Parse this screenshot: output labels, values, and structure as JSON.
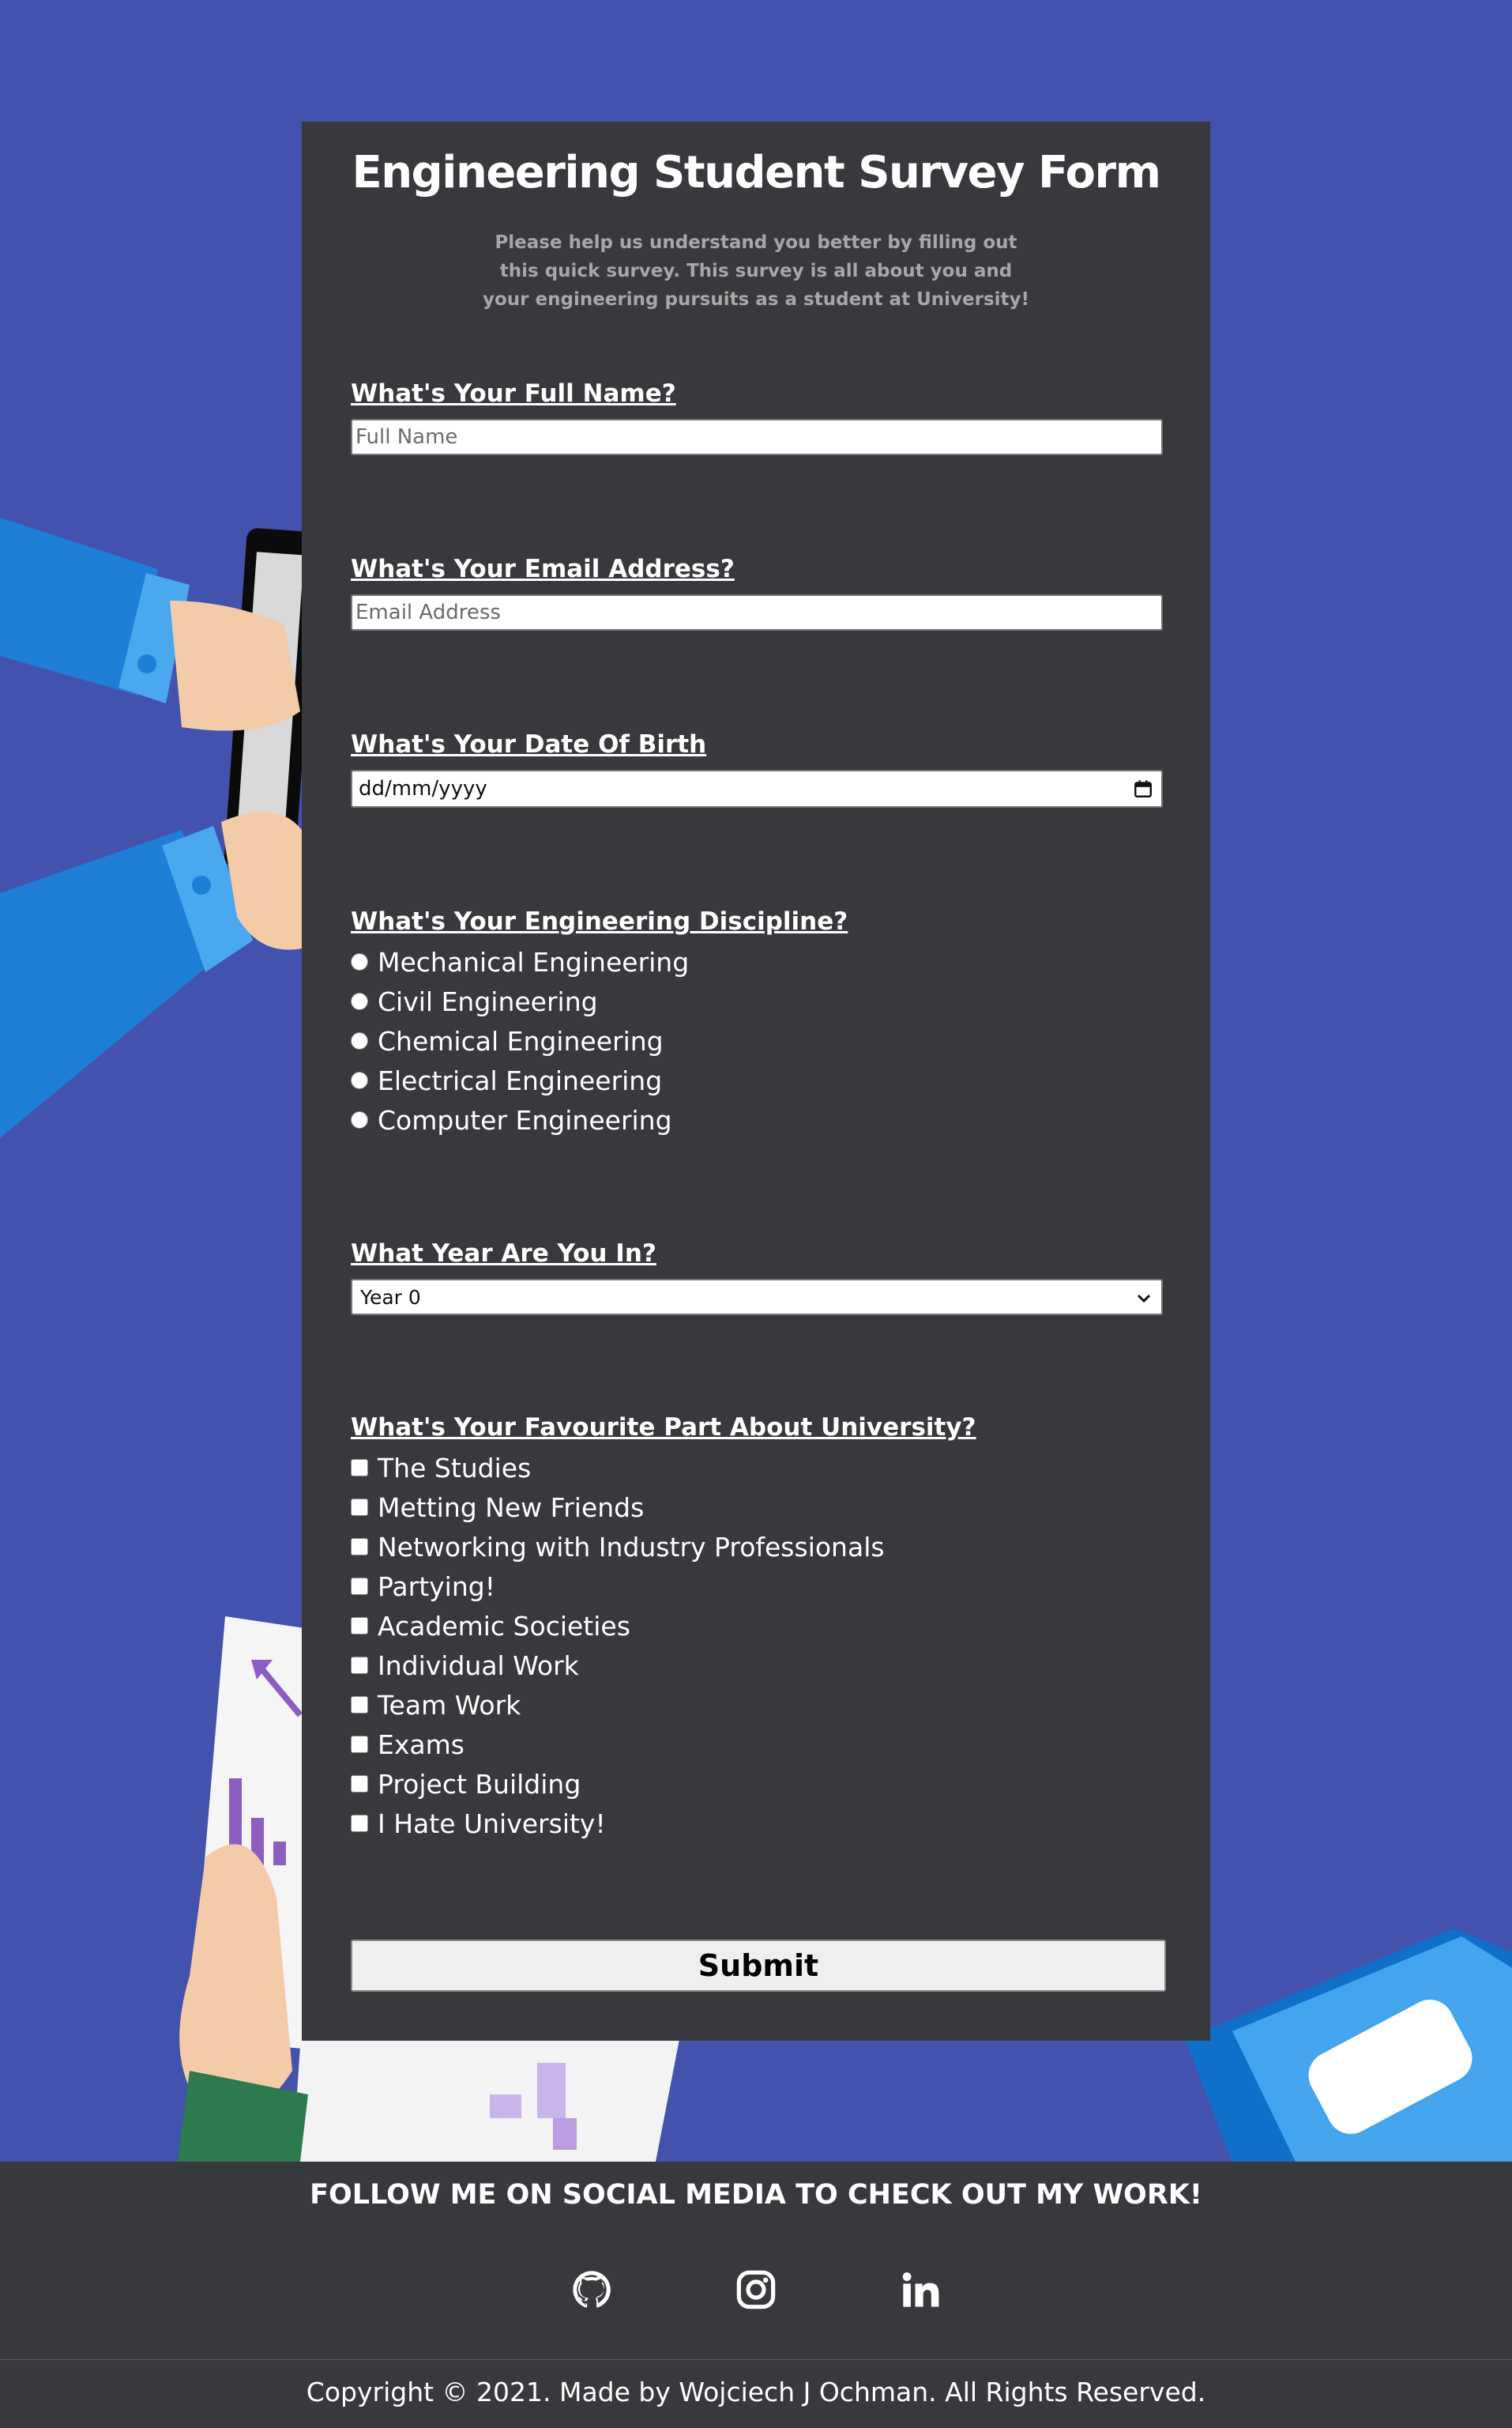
{
  "form": {
    "title": "Engineering Student Survey Form",
    "description": "Please help us understand you better by filling out this quick survey. This survey is all about you and your engineering pursuits as a student at University!",
    "name": {
      "label": "What's Your Full Name?",
      "placeholder": "Full Name"
    },
    "email": {
      "label": "What's Your Email Address?",
      "placeholder": "Email Address"
    },
    "dob": {
      "label": "What's Your Date Of Birth",
      "placeholder": "dd/mm/yyyy",
      "icon": "calendar-icon"
    },
    "discipline": {
      "label": "What's Your Engineering Discipline?",
      "options": [
        "Mechanical Engineering",
        "Civil Engineering",
        "Chemical Engineering",
        "Electrical Engineering",
        "Computer Engineering"
      ]
    },
    "year": {
      "label": "What Year Are You In?",
      "selected": "Year 0",
      "icon": "chevron-down-icon"
    },
    "favourite": {
      "label": "What's Your Favourite Part About University?",
      "options": [
        "The Studies",
        "Metting New Friends",
        "Networking with Industry Professionals",
        "Partying!",
        "Academic Societies",
        "Individual Work",
        "Team Work",
        "Exams",
        "Project Building",
        "I Hate University!"
      ]
    },
    "submit_label": "Submit"
  },
  "footer": {
    "follow_text": "FOLLOW ME ON SOCIAL MEDIA TO CHECK OUT MY WORK!",
    "socials": [
      "github-icon",
      "instagram-icon",
      "linkedin-icon"
    ],
    "copyright": "Copyright © 2021. Made by Wojciech J Ochman. All Rights Reserved."
  },
  "colors": {
    "background": "#4252ad",
    "panel": "#38393c",
    "description_text": "#a7a7a7"
  }
}
